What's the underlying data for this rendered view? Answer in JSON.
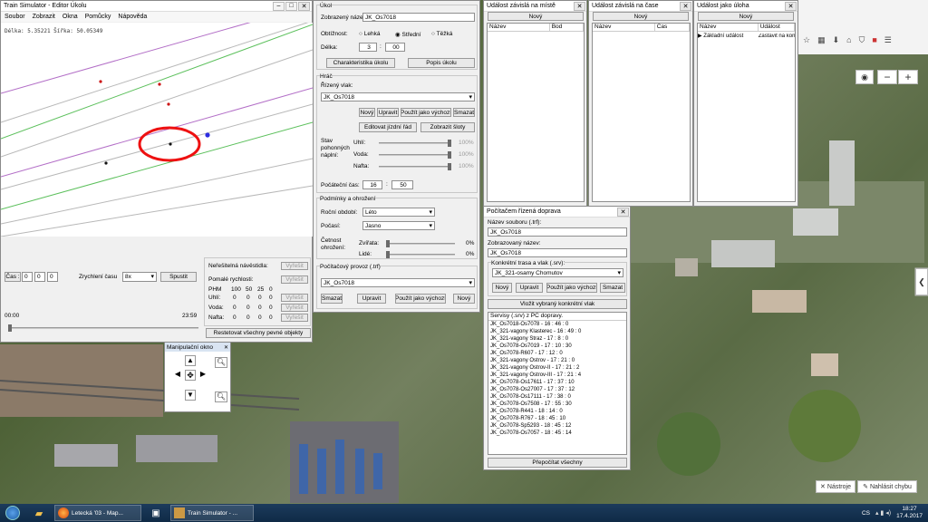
{
  "editor": {
    "title": "Train Simulator - Editor Úkolu",
    "menu": [
      "Soubor",
      "Zobrazit",
      "Okna",
      "Pomůcky",
      "Nápověda"
    ],
    "coords": "Délka: 5.35221 Šířka: 50.05349"
  },
  "time_panel": {
    "cas_button": "Čas :",
    "h": "0",
    "m": "0",
    "s": "0",
    "speed_label": "Zrychlení času",
    "speed_value": "8x",
    "start_button": "Spustit",
    "time_start": "00:00",
    "time_end": "23:59"
  },
  "marker_panel": {
    "row1_label": "Neřešitelná návěstidla:",
    "row2_label": "Pomalé rychlosti:",
    "fix": "Vyřešit",
    "cols": [
      "PHM",
      "100",
      "50",
      "25",
      "0"
    ],
    "rows": [
      {
        "label": "Uhlí:",
        "vals": [
          "0",
          "0",
          "0",
          "0"
        ]
      },
      {
        "label": "Voda:",
        "vals": [
          "0",
          "0",
          "0",
          "0"
        ]
      },
      {
        "label": "Nafta:",
        "vals": [
          "0",
          "0",
          "0",
          "0"
        ]
      }
    ],
    "reset_button": "Restetovat všechny pevné objekty"
  },
  "manip": {
    "title": "Manipulační okno"
  },
  "ukol": {
    "group_title": "Úkol",
    "display_name_label": "Zobrazený název:",
    "display_name_value": "JK_Os7018",
    "difficulty_label": "Obtížnost:",
    "diff_options": [
      "Lehká",
      "Střední",
      "Těžká"
    ],
    "length_label": "Délka:",
    "length_h": "3",
    "length_m": "00",
    "char_button": "Charakteristika úkolu",
    "desc_button": "Popis úkolu"
  },
  "hrac": {
    "group_title": "Hráč",
    "train_label": "Řízený vlak:",
    "train_value": "JK_Os7018",
    "buttons": [
      "Nový",
      "Upravit",
      "Použít jako výchozí",
      "Smazat"
    ],
    "edit_timetable": "Editovat jízdní řád",
    "show_signals": "Zobrazit šloty",
    "fuel_state_label": "Stav pohonných náplní:",
    "fuel": [
      {
        "label": "Uhlí:",
        "pct": "100%"
      },
      {
        "label": "Voda:",
        "pct": "100%"
      },
      {
        "label": "Nafta:",
        "pct": "100%"
      }
    ],
    "start_time_label": "Počáteční čas:",
    "start_h": "16",
    "start_m": "50"
  },
  "podminky": {
    "group_title": "Podmínky a ohrožení",
    "season_label": "Roční období:",
    "season_value": "Léto",
    "weather_label": "Počasí:",
    "weather_value": "Jasno",
    "freq_label": "Četnost ohrožení:",
    "animals_label": "Zvířata:",
    "animals_pct": "0%",
    "people_label": "Lidé:",
    "people_pct": "0%"
  },
  "provoz": {
    "group_title": "Počítačový provoz (.trf)",
    "value": "JK_Os7018",
    "buttons": [
      "Smazat",
      "Upravit",
      "Použít jako výchozí",
      "Nový"
    ]
  },
  "ud_misto": {
    "title": "Událost závislá na místě",
    "new": "Nový",
    "cols": [
      "Název",
      "Bod"
    ]
  },
  "ud_cas": {
    "title": "Událost závislá na čase",
    "new": "Nový",
    "cols": [
      "Název",
      "Čas"
    ]
  },
  "ud_uloha": {
    "title": "Událost jako úloha",
    "new": "Nový",
    "cols": [
      "Název",
      "Událost"
    ],
    "rows": [
      {
        "name": "Základní událost",
        "event": "Zastavit na konc"
      }
    ]
  },
  "pc_doprava": {
    "title": "Počítačem řízená doprava",
    "file_label": "Název souboru (.trf):",
    "file_value": "JK_Os7018",
    "display_label": "Zobrazovaný název:",
    "display_value": "JK_Os7018",
    "route_group": "Konkrétní trasa a vlak (.srv):",
    "route_value": "JK_321-osamy Chomutov",
    "buttons": [
      "Nový",
      "Upravit",
      "Použít jako výchozí",
      "Smazat"
    ],
    "insert_button": "Vložit vybraný konkrétní vlak",
    "list_header": "Servisy (.srv) z PC dopravy.",
    "services": [
      "JK_Os7018-Os7078 - 16 : 46 : 0",
      "JK_321-vagony Klasterec - 16 : 49 : 0",
      "JK_321-vagony Straz - 17 : 8 : 0",
      "JK_Os7078-Os7019 - 17 : 10 : 30",
      "JK_Os7078-R607 - 17 : 12 : 0",
      "JK_321-vagony Ostrov - 17 : 21 : 0",
      "JK_321-vagony Ostrov-II - 17 : 21 : 2",
      "JK_321-vagony Ostrov-III - 17 : 21 : 4",
      "JK_Os7078-Os17611 - 17 : 37 : 10",
      "JK_Os7078-Os27007 - 17 : 37 : 12",
      "JK_Os7078-Os17111 - 17 : 38 : 0",
      "JK_Os7078-Os7508 - 17 : 55 : 30",
      "JK_Os7078-R441 - 18 : 14 : 0",
      "JK_Os7078-R767 - 18 : 45 : 10",
      "JK_Os7078-Sp5293 - 18 : 45 : 12",
      "JK_Os7078-Os7057 - 18 : 45 : 14"
    ],
    "recalc_button": "Přepočítat všechny"
  },
  "map": {
    "tools": "Nástroje",
    "report": "Nahlásit chybu",
    "zoom_in": "+",
    "zoom_out": "−"
  },
  "taskbar": {
    "items": [
      "Letecká '03 - Map...",
      "Train Simulator - ..."
    ],
    "lang": "CS",
    "time": "18:27",
    "date": "17.4.2017"
  }
}
